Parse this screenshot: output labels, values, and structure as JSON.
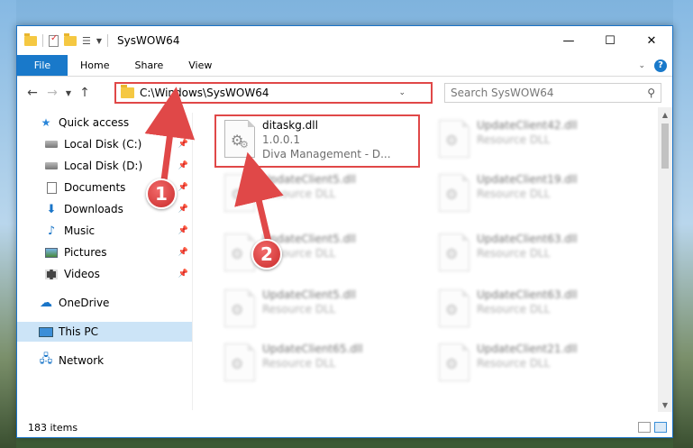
{
  "window": {
    "title": "SysWOW64",
    "minimize": "—",
    "maximize": "☐",
    "close": "✕"
  },
  "ribbon": {
    "tabs": [
      "File",
      "Home",
      "Share",
      "View"
    ],
    "help": "?"
  },
  "address": {
    "path": "C:\\Windows\\SysWOW64",
    "search_placeholder": "Search SysWOW64"
  },
  "nav": {
    "items": [
      {
        "label": "Quick access",
        "icon": "star-icon",
        "pinned": false
      },
      {
        "label": "Local Disk (C:)",
        "icon": "disk-icon",
        "pinned": true
      },
      {
        "label": "Local Disk (D:)",
        "icon": "disk-icon",
        "pinned": true
      },
      {
        "label": "Documents",
        "icon": "documents-icon",
        "pinned": true
      },
      {
        "label": "Downloads",
        "icon": "downloads-icon",
        "pinned": true
      },
      {
        "label": "Music",
        "icon": "music-icon",
        "pinned": true
      },
      {
        "label": "Pictures",
        "icon": "pictures-icon",
        "pinned": true
      },
      {
        "label": "Videos",
        "icon": "videos-icon",
        "pinned": true
      },
      {
        "label": "OneDrive",
        "icon": "cloud-icon",
        "pinned": false
      },
      {
        "label": "This PC",
        "icon": "pc-icon",
        "pinned": false,
        "selected": true
      },
      {
        "label": "Network",
        "icon": "network-icon",
        "pinned": false
      }
    ]
  },
  "files": {
    "highlighted": {
      "name": "ditaskg.dll",
      "version": "1.0.0.1",
      "description": "Diva Management - D..."
    },
    "blurred": [
      {
        "name": "UpdateClient42.dll",
        "type": "Resource DLL"
      },
      {
        "name": "UpdateClient5.dll",
        "type": "Resource DLL"
      },
      {
        "name": "UpdateClient19.dll",
        "type": "Resource DLL"
      },
      {
        "name": "UpdateClient5.dll",
        "type": "Resource DLL"
      },
      {
        "name": "UpdateClient63.dll",
        "type": "Resource DLL"
      },
      {
        "name": "UpdateClient5.dll",
        "type": "Resource DLL"
      },
      {
        "name": "UpdateClient63.dll",
        "type": "Resource DLL"
      },
      {
        "name": "UpdateClient65.dll",
        "type": "Resource DLL"
      },
      {
        "name": "UpdateClient21.dll",
        "type": "Resource DLL"
      }
    ]
  },
  "status": {
    "item_count": "183 items"
  },
  "annotations": {
    "step1": "1",
    "step2": "2",
    "accent_color": "#e04848"
  }
}
